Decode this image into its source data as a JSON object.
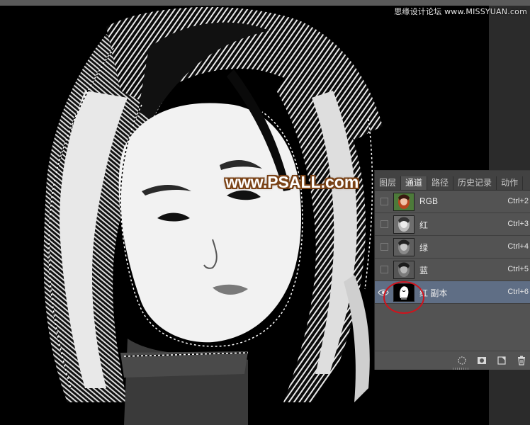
{
  "source_label": "思缘设计论坛 www.MISSYUAN.com",
  "watermark": "www.PSALL.com",
  "channels_panel": {
    "tabs": [
      {
        "label": "图层",
        "active": false
      },
      {
        "label": "通道",
        "active": true
      },
      {
        "label": "路径",
        "active": false
      },
      {
        "label": "历史记录",
        "active": false
      },
      {
        "label": "动作",
        "active": false
      }
    ],
    "channels": [
      {
        "name": "RGB",
        "shortcut": "Ctrl+2",
        "visible": false,
        "selected": false,
        "thumb": "color"
      },
      {
        "name": "红",
        "shortcut": "Ctrl+3",
        "visible": false,
        "selected": false,
        "thumb": "gray"
      },
      {
        "name": "绿",
        "shortcut": "Ctrl+4",
        "visible": false,
        "selected": false,
        "thumb": "gray"
      },
      {
        "name": "蓝",
        "shortcut": "Ctrl+5",
        "visible": false,
        "selected": false,
        "thumb": "gray"
      },
      {
        "name": "红 副本",
        "shortcut": "Ctrl+6",
        "visible": true,
        "selected": true,
        "thumb": "mask"
      }
    ],
    "bottom_icons": [
      "load-selection-icon",
      "save-selection-icon",
      "new-channel-icon",
      "delete-channel-icon"
    ]
  },
  "colors": {
    "panel_bg": "#535353",
    "selected_row": "#5f6e85",
    "annotation_circle": "#d0131c",
    "watermark_outline": "#7a4216"
  }
}
